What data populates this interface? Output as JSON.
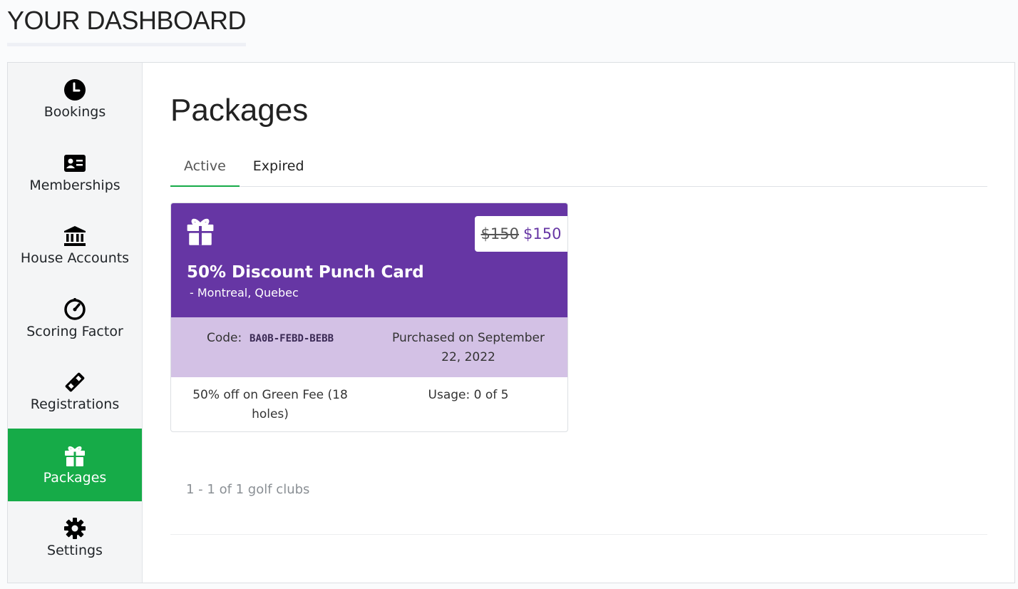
{
  "header": {
    "title": "YOUR DASHBOARD"
  },
  "sidebar": {
    "items": [
      {
        "label": "Bookings",
        "icon": "clock-icon"
      },
      {
        "label": "Memberships",
        "icon": "id-card-icon"
      },
      {
        "label": "House Accounts",
        "icon": "bank-icon"
      },
      {
        "label": "Scoring Factor",
        "icon": "gauge-icon"
      },
      {
        "label": "Registrations",
        "icon": "ticket-icon"
      },
      {
        "label": "Packages",
        "icon": "gift-icon",
        "active": true
      },
      {
        "label": "Settings",
        "icon": "gear-icon"
      }
    ],
    "active_color": "#16ab48"
  },
  "main": {
    "title": "Packages",
    "tabs": [
      {
        "label": "Active",
        "active": true
      },
      {
        "label": "Expired",
        "active": false
      }
    ],
    "package": {
      "price_old": "$150",
      "price_new": "$150",
      "name": "50% Discount Punch Card",
      "location": "-  Montreal, Quebec",
      "code_label": "Code:",
      "code_value": "BA0B-FEBD-BEBB",
      "purchased": "Purchased on September 22, 2022",
      "description": "50% off on Green Fee (18 holes)",
      "usage": "Usage: 0 of 5",
      "header_color": "#6636a4",
      "meta_color": "#d3c1e5"
    },
    "pagination": "1 - 1 of 1 golf clubs"
  }
}
